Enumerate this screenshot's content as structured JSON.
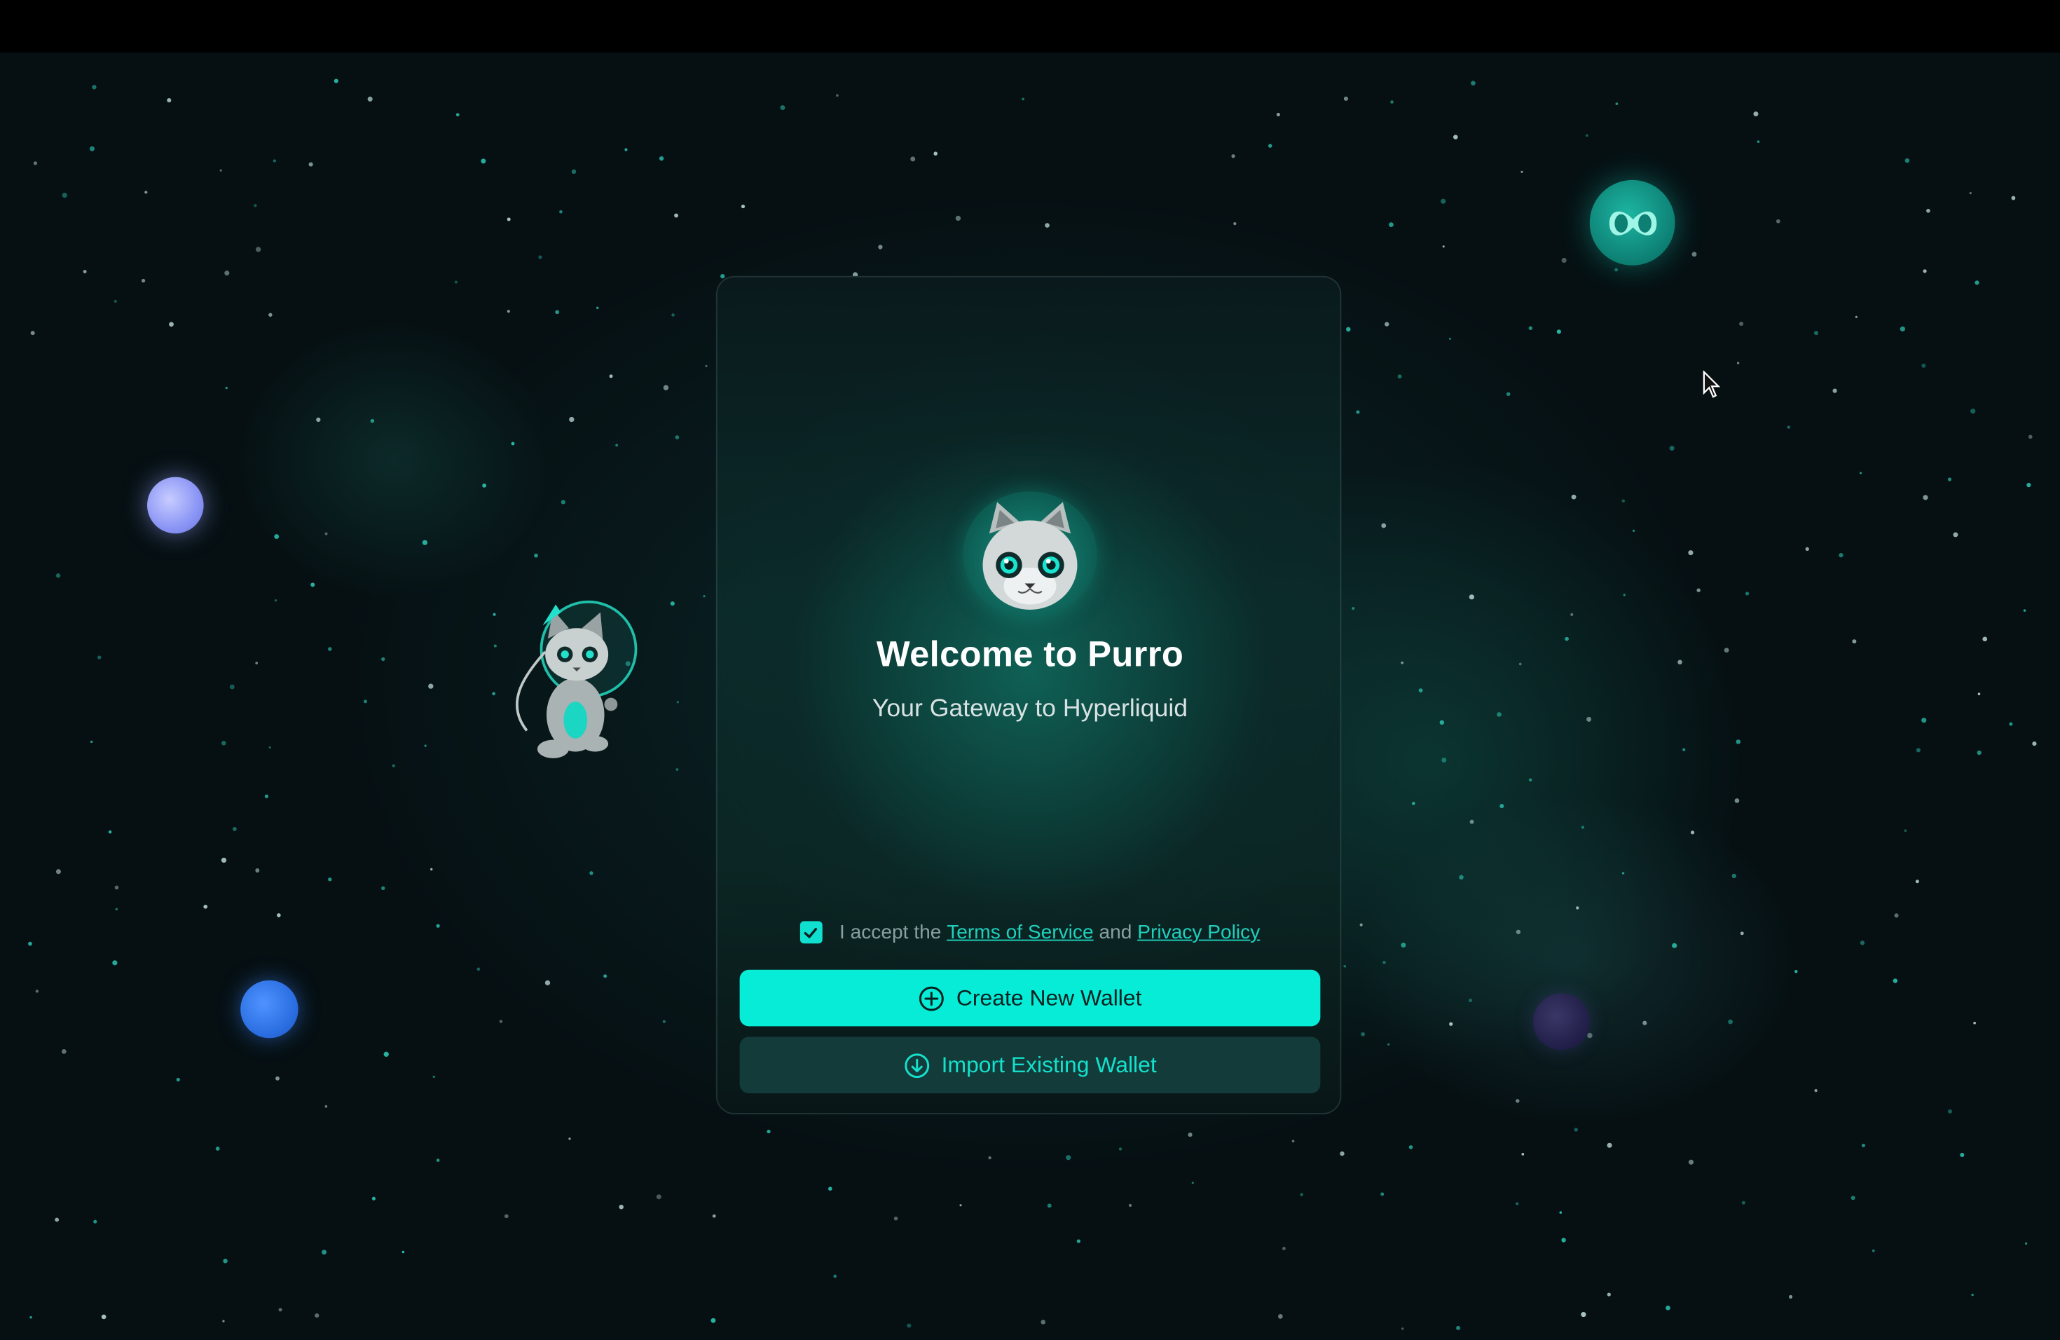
{
  "welcome": {
    "title": "Welcome to Purro",
    "subtitle": "Your Gateway to Hyperliquid"
  },
  "terms": {
    "accepted": true,
    "prefix": "I accept the ",
    "terms_link": "Terms of Service",
    "conjunction": " and ",
    "privacy_link": "Privacy Policy"
  },
  "actions": {
    "create_label": "Create New Wallet",
    "create_icon": "plus-circle-icon",
    "import_label": "Import Existing Wallet",
    "import_icon": "arrow-down-circle-icon"
  },
  "decor": {
    "logo": "purro-cat-logo",
    "badge": "hyperliquid-logo",
    "mascot": "astronaut-cat"
  },
  "colors": {
    "accent": "#06ecd7",
    "background": "#061013",
    "card": "#0b2a29",
    "secondary_button": "#123b3a",
    "link": "#1fd0bd"
  }
}
